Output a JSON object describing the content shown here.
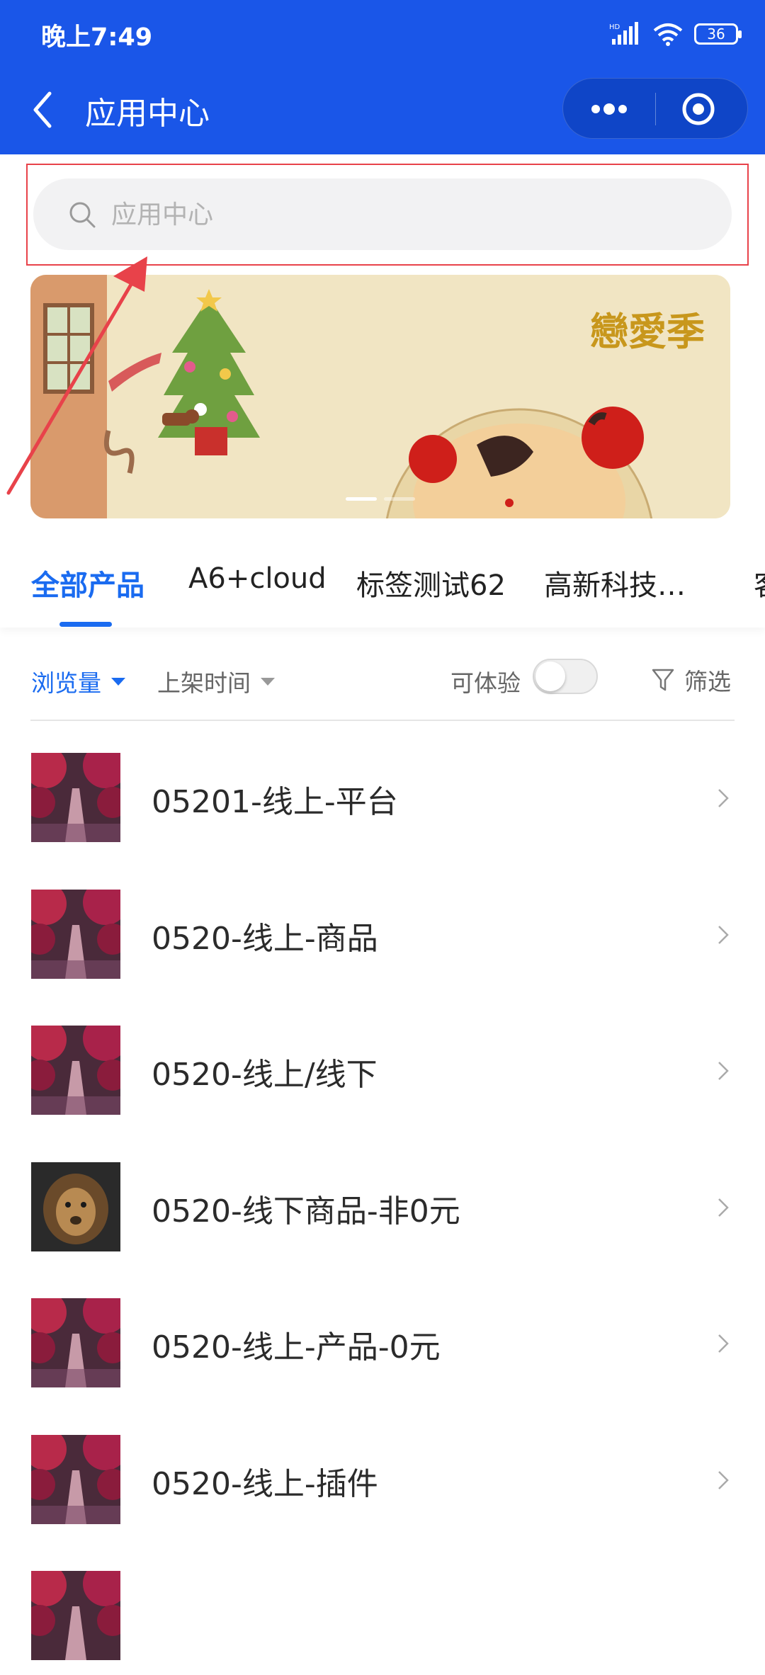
{
  "status_bar": {
    "time": "晚上7:49",
    "network": "HD",
    "battery": "36"
  },
  "header": {
    "title": "应用中心",
    "back_icon": "back-arrow-icon",
    "more_icon": "more-dots-icon",
    "close_icon": "target-circle-icon"
  },
  "search": {
    "placeholder": "应用中心",
    "value": ""
  },
  "banner": {
    "title": "戀愛季",
    "active_slide": 1,
    "slide_count": 2
  },
  "tabs": [
    {
      "label": "全部产品",
      "active": true
    },
    {
      "label": "A6+cloud",
      "active": false
    },
    {
      "label": "标签测试62",
      "active": false
    },
    {
      "label": "高新科技…",
      "active": false
    },
    {
      "label": "客",
      "active": false
    }
  ],
  "filters": {
    "sort_views": "浏览量",
    "sort_time": "上架时间",
    "trial_label": "可体验",
    "trial_enabled": false,
    "filter_label": "筛选"
  },
  "products": [
    {
      "name": "05201-线上-平台",
      "thumb": "autumn-path"
    },
    {
      "name": "0520-线上-商品",
      "thumb": "autumn-path"
    },
    {
      "name": "0520-线上/线下",
      "thumb": "autumn-path"
    },
    {
      "name": "0520-线下商品-非0元",
      "thumb": "lion"
    },
    {
      "name": "0520-线上-产品-0元",
      "thumb": "autumn-path"
    },
    {
      "name": "0520-线上-插件",
      "thumb": "autumn-path"
    },
    {
      "name": "",
      "thumb": "autumn-path"
    }
  ],
  "colors": {
    "header_bg": "#1a56e8",
    "accent": "#1a6bf0",
    "highlight": "#e8424a"
  }
}
